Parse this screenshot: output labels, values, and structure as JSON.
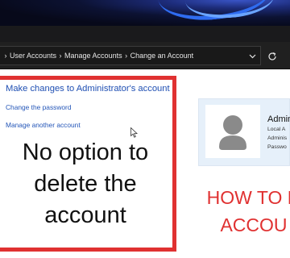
{
  "breadcrumb": {
    "items": [
      "User Accounts",
      "Manage Accounts",
      "Change an Account"
    ],
    "separator": "›"
  },
  "panel": {
    "heading": "Make changes to Administrator's account",
    "links": [
      "Change the password",
      "Manage another account"
    ]
  },
  "overlay": {
    "main_text": [
      "No option to",
      "delete the",
      "account"
    ],
    "side_text": [
      "HOW TO D",
      "ACCOU"
    ]
  },
  "account_card": {
    "name": "Admin",
    "lines": [
      "Local A",
      "Adminis",
      "Passwo"
    ]
  },
  "colors": {
    "highlight_red": "#e03131",
    "link_blue": "#2456b8",
    "card_bg": "#e6f0fa"
  },
  "icons": {
    "address_dropdown": "chevron-down-icon",
    "refresh": "refresh-icon",
    "avatar": "user-avatar-icon",
    "pointer": "mouse-pointer-icon"
  }
}
